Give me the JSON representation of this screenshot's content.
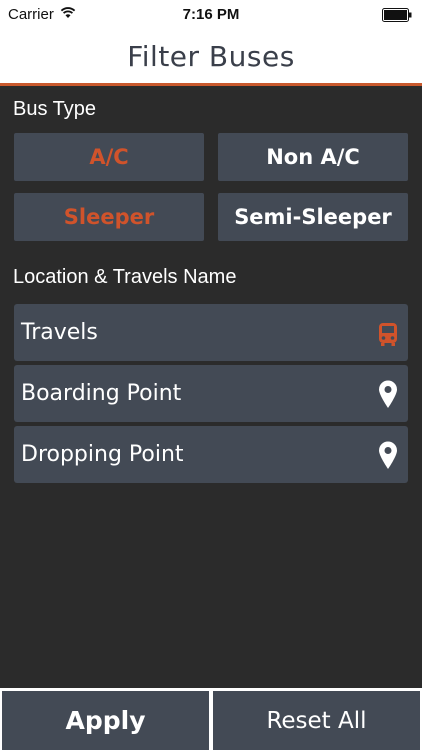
{
  "status_bar": {
    "carrier": "Carrier",
    "time": "7:16 PM",
    "wifi_icon": "wifi-icon",
    "battery_icon": "battery-icon"
  },
  "header": {
    "title": "Filter Buses",
    "accent_color": "#c9592d"
  },
  "bus_type": {
    "label": "Bus Type",
    "options": [
      {
        "label": "A/C",
        "selected": true
      },
      {
        "label": "Non A/C",
        "selected": false
      },
      {
        "label": "Sleeper",
        "selected": true
      },
      {
        "label": "Semi-Sleeper",
        "selected": false
      }
    ],
    "selected_color": "#d0532b"
  },
  "location": {
    "label": "Location & Travels Name",
    "rows": [
      {
        "label": "Travels",
        "icon": "bus-icon"
      },
      {
        "label": "Boarding Point",
        "icon": "map-pin-icon"
      },
      {
        "label": "Dropping Point",
        "icon": "map-pin-icon"
      }
    ]
  },
  "footer": {
    "apply_label": "Apply",
    "reset_label": "Reset All"
  }
}
